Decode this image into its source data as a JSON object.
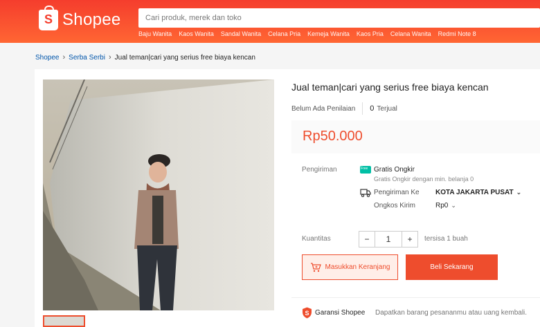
{
  "header": {
    "brand": "Shopee",
    "logo_letter": "S",
    "search_placeholder": "Cari produk, merek dan toko",
    "keywords": [
      "Baju Wanita",
      "Kaos Wanita",
      "Sandal Wanita",
      "Celana Pria",
      "Kemeja Wanita",
      "Kaos Pria",
      "Celana Wanita",
      "Redmi Note 8"
    ]
  },
  "breadcrumb": {
    "items": [
      "Shopee",
      "Serba Serbi"
    ],
    "current": "Jual teman|cari yang serius free biaya kencan"
  },
  "product": {
    "title": "Jual teman|cari yang serius free biaya kencan",
    "rating_text": "Belum Ada Penilaian",
    "sold_count": "0",
    "sold_label": "Terjual",
    "price": "Rp50.000"
  },
  "shipping": {
    "label": "Pengiriman",
    "free_title": "Gratis Ongkir",
    "free_sub": "Gratis Ongkir dengan min. belanja 0",
    "ship_to_label": "Pengiriman Ke",
    "ship_to_value": "KOTA JAKARTA PUSAT",
    "cost_label": "Ongkos Kirim",
    "cost_value": "Rp0"
  },
  "quantity": {
    "label": "Kuantitas",
    "minus": "−",
    "value": "1",
    "plus": "+",
    "stock": "tersisa 1 buah"
  },
  "actions": {
    "add_to_cart": "Masukkan Keranjang",
    "buy_now": "Beli Sekarang"
  },
  "guarantee": {
    "title": "Garansi Shopee",
    "text": "Dapatkan barang pesananmu atau uang kembali."
  },
  "colors": {
    "brand": "#ee4d2d",
    "free_shipping": "#00bfa5",
    "link": "#0055aa"
  },
  "icons": [
    "shopee-bag-icon",
    "free-shipping-icon",
    "truck-icon",
    "chevron-down-icon",
    "cart-icon",
    "shield-icon"
  ]
}
